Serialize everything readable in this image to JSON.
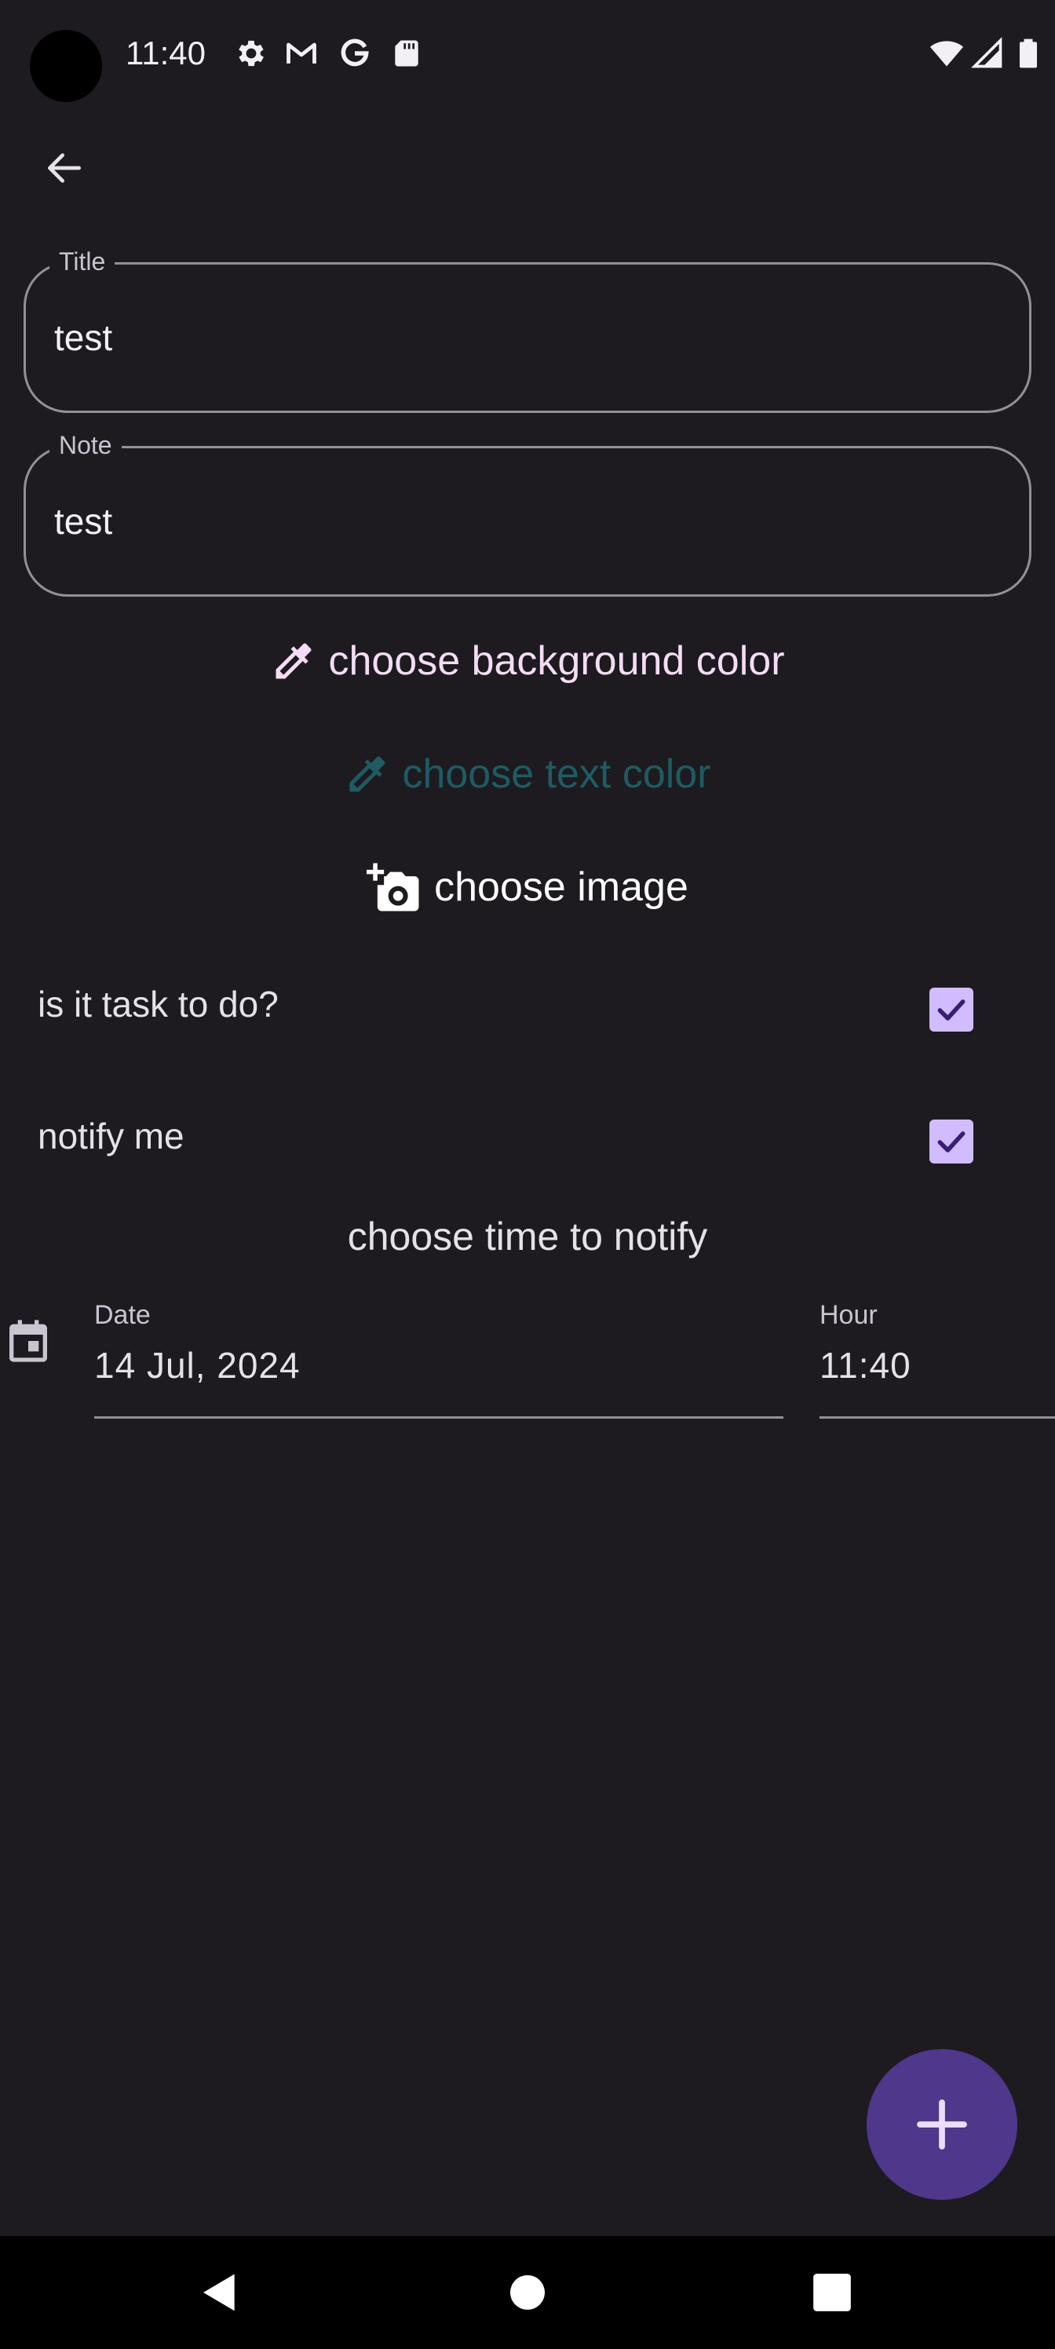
{
  "status_bar": {
    "time": "11:40",
    "left_icons": [
      "settings-icon",
      "gmail-icon",
      "google-icon",
      "sd-card-icon"
    ],
    "right_icons": [
      "wifi-icon",
      "signal-icon",
      "battery-icon"
    ]
  },
  "app_bar": {
    "back_icon": "arrow-back-icon"
  },
  "form": {
    "title": {
      "label": "Title",
      "value": "test"
    },
    "note": {
      "label": "Note",
      "value": "test"
    }
  },
  "actions": {
    "background_color": {
      "label": "choose background color",
      "icon": "eyedropper-icon",
      "color": "#f3dcf4"
    },
    "text_color": {
      "label": "choose text color",
      "icon": "eyedropper-icon",
      "color": "#1e5b62"
    },
    "image": {
      "label": "choose image",
      "icon": "add-a-photo-icon",
      "color": "#ffffff"
    }
  },
  "toggles": {
    "task": {
      "label": "is it task to do?",
      "checked": true
    },
    "notify": {
      "label": "notify me",
      "checked": true
    }
  },
  "notify": {
    "title": "choose time to notify",
    "date": {
      "label": "Date",
      "value": "14 Jul, 2024"
    },
    "hour": {
      "label": "Hour",
      "value": "11:40"
    }
  },
  "fab": {
    "icon": "plus-icon",
    "color": "#4f378b"
  },
  "nav": {
    "icons": [
      "back-triangle-icon",
      "home-circle-icon",
      "recents-square-icon"
    ]
  },
  "theme": {
    "background": "#1d1b20",
    "accent": "#d0bcff"
  }
}
